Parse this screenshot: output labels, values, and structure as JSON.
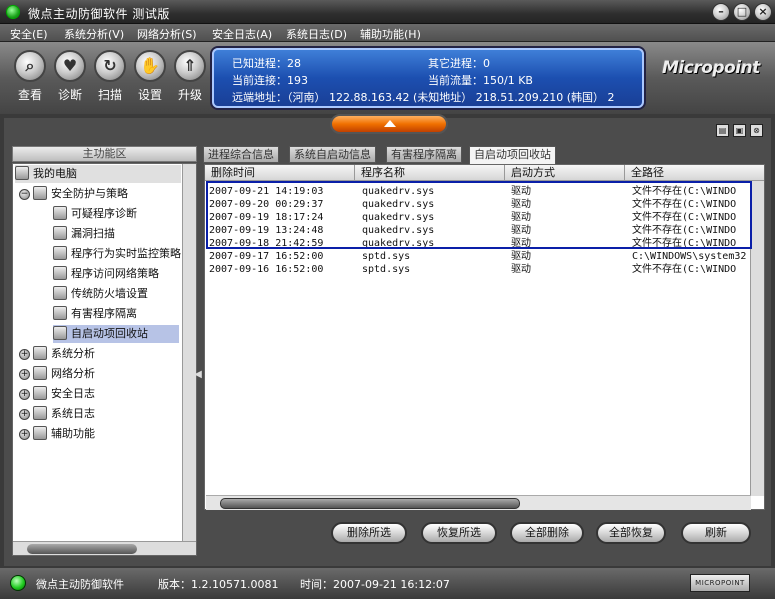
{
  "window": {
    "title": "微点主动防御软件  测试版"
  },
  "menu": [
    {
      "label": "安全(E)"
    },
    {
      "label": "系统分析(V)"
    },
    {
      "label": "网络分析(S)"
    },
    {
      "label": "安全日志(A)"
    },
    {
      "label": "系统日志(D)"
    },
    {
      "label": "辅助功能(H)"
    }
  ],
  "toolbar": [
    {
      "label": "查看",
      "icon": "magnifier-icon"
    },
    {
      "label": "诊断",
      "icon": "heart-icon"
    },
    {
      "label": "扫描",
      "icon": "scan-icon"
    },
    {
      "label": "设置",
      "icon": "hand-icon"
    },
    {
      "label": "升级",
      "icon": "upgrade-icon"
    }
  ],
  "info": {
    "known_process": "已知进程：28",
    "other_process": "其它进程：0",
    "current_connections": "当前连接：193",
    "current_traffic": "当前流量：150/1 KB",
    "remote_address": "远端地址：（河南） 122.88.163.42 (未知地址） 218.51.209.210 (韩国） 2"
  },
  "brand": "Micropoint",
  "left_panel": {
    "header": "主功能区",
    "tree": [
      {
        "label": "我的电脑"
      },
      {
        "label": "安全防护与策略"
      },
      {
        "label": "可疑程序诊断"
      },
      {
        "label": "漏洞扫描"
      },
      {
        "label": "程序行为实时监控策略"
      },
      {
        "label": "程序访问网络策略"
      },
      {
        "label": "传统防火墙设置"
      },
      {
        "label": "有害程序隔离"
      },
      {
        "label": "自启动项回收站"
      },
      {
        "label": "系统分析"
      },
      {
        "label": "网络分析"
      },
      {
        "label": "安全日志"
      },
      {
        "label": "系统日志"
      },
      {
        "label": "辅助功能"
      }
    ]
  },
  "tabs": [
    {
      "label": "进程综合信息"
    },
    {
      "label": "系统自启动信息"
    },
    {
      "label": "有害程序隔离"
    },
    {
      "label": "自启动项回收站"
    }
  ],
  "table": {
    "columns": [
      "删除时间",
      "程序名称",
      "启动方式",
      "全路径"
    ],
    "rows": [
      [
        "2007-09-21 14:19:03",
        "quakedrv.sys",
        "驱动",
        "文件不存在(C:\\WINDO"
      ],
      [
        "2007-09-20 00:29:37",
        "quakedrv.sys",
        "驱动",
        "文件不存在(C:\\WINDO"
      ],
      [
        "2007-09-19 18:17:24",
        "quakedrv.sys",
        "驱动",
        "文件不存在(C:\\WINDO"
      ],
      [
        "2007-09-19 13:24:48",
        "quakedrv.sys",
        "驱动",
        "文件不存在(C:\\WINDO"
      ],
      [
        "2007-09-18 21:42:59",
        "quakedrv.sys",
        "驱动",
        "文件不存在(C:\\WINDO"
      ],
      [
        "2007-09-17 16:52:00",
        "sptd.sys",
        "驱动",
        "C:\\WINDOWS\\system32"
      ],
      [
        "2007-09-16 16:52:00",
        "sptd.sys",
        "驱动",
        "文件不存在(C:\\WINDO"
      ]
    ]
  },
  "actions": [
    {
      "label": "删除所选"
    },
    {
      "label": "恢复所选"
    },
    {
      "label": "全部删除"
    },
    {
      "label": "全部恢复"
    },
    {
      "label": "刷新"
    }
  ],
  "status": {
    "app": "微点主动防御软件",
    "version": "版本：1.2.10571.0081",
    "time": "时间：2007-09-21 16:12:07",
    "badge": "MICROPOINT"
  },
  "colors": {
    "accent": "#1c4fb0",
    "highlight_border": "#0a1fa8",
    "toggle": "#f07000"
  }
}
